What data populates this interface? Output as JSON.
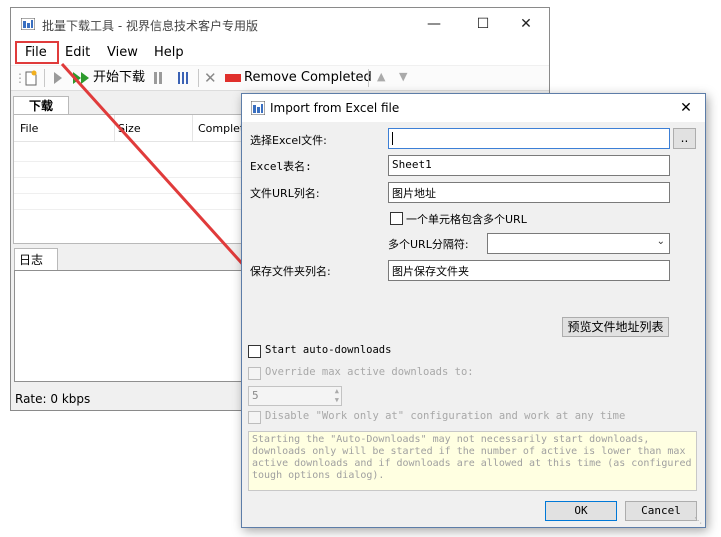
{
  "main_window": {
    "title": "批量下载工具 - 视界信息技术客户专用版",
    "menu": [
      "File",
      "Edit",
      "View",
      "Help"
    ],
    "toolbar": {
      "start": "开始下载",
      "remove_completed": "Remove Completed"
    },
    "download_tab": "下载",
    "columns": [
      "File",
      "Size",
      "Complete"
    ],
    "log_tab": "日志",
    "status": "Rate:  0 kbps"
  },
  "dialog": {
    "title": "Import from Excel file",
    "select_label": "选择Excel文件:",
    "select_value": "",
    "browse": "..",
    "sheet_label": "Excel表名:",
    "sheet_value": "Sheet1",
    "url_col_label": "文件URL列名:",
    "url_col_value": "图片地址",
    "multi_url_label": "一个单元格包含多个URL",
    "separator_label": "多个URL分隔符:",
    "separator_value": "",
    "folder_col_label": "保存文件夹列名:",
    "folder_col_value": "图片保存文件夹",
    "preview_button": "预览文件地址列表",
    "auto_downloads": "Start auto-downloads",
    "override_max": "Override max active downloads to:",
    "max_value": "5",
    "disable_work": "Disable \"Work only at\" configuration and work at any time",
    "note": "Starting the \"Auto-Downloads\" may not necessarily start downloads, downloads only will be started if the number of active is lower than max active downloads and if downloads are allowed at this time (as configured tough options dialog).",
    "ok": "OK",
    "cancel": "Cancel"
  },
  "colors": {
    "highlight": "#e03b3b",
    "dialog_border": "#5d7da8",
    "note_bg": "#ffffe1"
  }
}
